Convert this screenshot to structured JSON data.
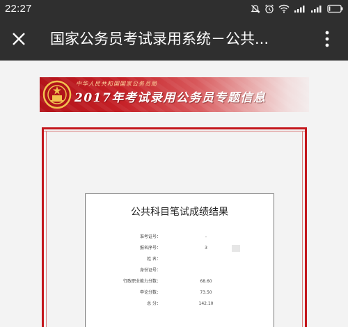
{
  "status_bar": {
    "time": "22:27",
    "icons": [
      "mute-icon",
      "alarm-icon",
      "wifi-icon",
      "signal-icon",
      "signal-icon",
      "battery-icon"
    ]
  },
  "title_bar": {
    "title": "国家公务员考试录用系统－公共...",
    "close_icon": "close-icon",
    "menu_icon": "more-vertical-icon"
  },
  "banner": {
    "org_text": "中华人民共和国国家公务员局",
    "title": "2017年考试录用公务员专题信息",
    "emblem": "national-emblem"
  },
  "result": {
    "title": "公共科目笔试成绩结果",
    "rows": [
      {
        "label": "准考证号：",
        "value": "-"
      },
      {
        "label": "报名序号：",
        "value": "3"
      },
      {
        "label": "姓    名：",
        "value": ""
      },
      {
        "label": "身份证号：",
        "value": ""
      },
      {
        "label": "行政职业能力分数：",
        "value": "68.60"
      },
      {
        "label": "申论分数：",
        "value": "73.50"
      },
      {
        "label": "总    分：",
        "value": "142.10"
      }
    ]
  },
  "colors": {
    "toolbar": "#2f2f2f",
    "banner_red": "#c52026",
    "frame_red": "#c4161c"
  }
}
